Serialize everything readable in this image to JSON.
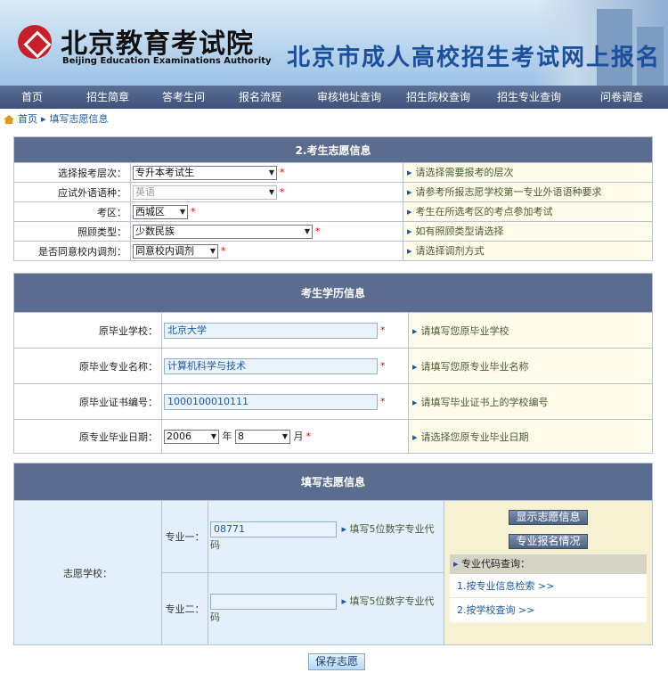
{
  "header": {
    "logo_cn": "北京教育考试院",
    "logo_en": "Beijing Education Examinations Authority",
    "site_title": "北京市成人高校招生考试网上报名"
  },
  "nav": [
    "首页",
    "招生简章",
    "答考生问",
    "报名流程",
    "审核地址查询",
    "招生院校查询",
    "招生专业查询",
    "问卷调查"
  ],
  "breadcrumb": {
    "home": "首页",
    "current": "填写志愿信息"
  },
  "section1": {
    "title": "2.考生志愿信息",
    "rows": [
      {
        "label": "选择报考层次：",
        "value": "专升本考试生",
        "hint": "请选择需要报考的层次"
      },
      {
        "label": "应试外语语种：",
        "value": "英语",
        "hint": "请参考所报志愿学校第一专业外语语种要求"
      },
      {
        "label": "考区：",
        "value": "西城区",
        "hint": "考生在所选考区的考点参加考试"
      },
      {
        "label": "照顾类型：",
        "value": "少数民族",
        "hint": "如有照顾类型请选择"
      },
      {
        "label": "是否同意校内调剂：",
        "value": "同意校内调剂",
        "hint": "请选择调剂方式"
      }
    ]
  },
  "section2": {
    "title": "考生学历信息",
    "rows": [
      {
        "label": "原毕业学校：",
        "value": "北京大学",
        "hint": "请填写您原毕业学校"
      },
      {
        "label": "原毕业专业名称：",
        "value": "计算机科学与技术",
        "hint": "请填写您原专业毕业名称"
      },
      {
        "label": "原毕业证书编号：",
        "value": "1000100010111",
        "hint": "请填写毕业证书上的学校编号"
      }
    ],
    "date": {
      "label": "原专业毕业日期：",
      "year": "2006",
      "year_unit": "年",
      "month": "8",
      "month_unit": "月",
      "hint": "请选择您原专业毕业日期"
    }
  },
  "section3": {
    "title": "填写志愿信息",
    "school_label": "志愿学校：",
    "major1": {
      "label": "专业一：",
      "value": "08771",
      "hint": "填写5位数字专业代码"
    },
    "major2": {
      "label": "专业二：",
      "value": "",
      "hint": "填写5位数字专业代码"
    },
    "buttons": {
      "show": "显示志愿信息",
      "status": "专业报名情况"
    },
    "code_query": {
      "title": "专业代码查询：",
      "link1": "1.按专业信息检索 >>",
      "link2": "2.按学校查询 >>"
    }
  },
  "save_button": "保存志愿"
}
